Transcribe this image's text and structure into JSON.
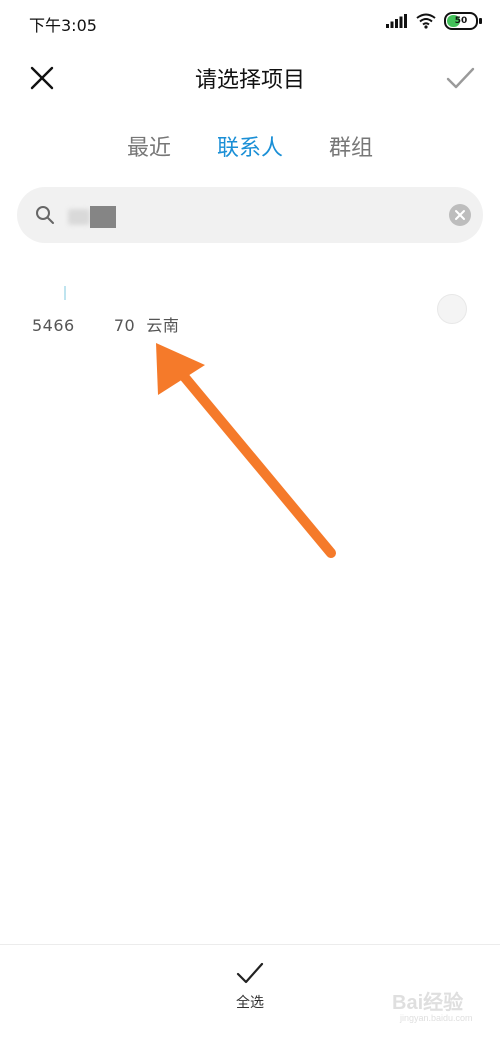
{
  "status_bar": {
    "time": "下午3:05",
    "battery": "50",
    "icons": [
      "signal-icon",
      "wifi-icon",
      "battery-icon"
    ]
  },
  "header": {
    "title": "请选择项目",
    "close_icon": "close-icon",
    "confirm_icon": "check-icon"
  },
  "tabs": [
    {
      "label": "最近",
      "active": false
    },
    {
      "label": "联系人",
      "active": true
    },
    {
      "label": "群组",
      "active": false
    }
  ],
  "search": {
    "icon": "search-icon",
    "value": "",
    "clear_icon": "clear-icon"
  },
  "results": [
    {
      "text": "5466       70  云南"
    }
  ],
  "bottom": {
    "select_all_label": "全选",
    "select_all_icon": "check-icon"
  },
  "watermark": {
    "text": "Bai经验",
    "sub": "jingyan.baidu.com"
  },
  "colors": {
    "accent": "#1a8fd6",
    "arrow": "#f57a2a",
    "battery": "#43c15a"
  }
}
